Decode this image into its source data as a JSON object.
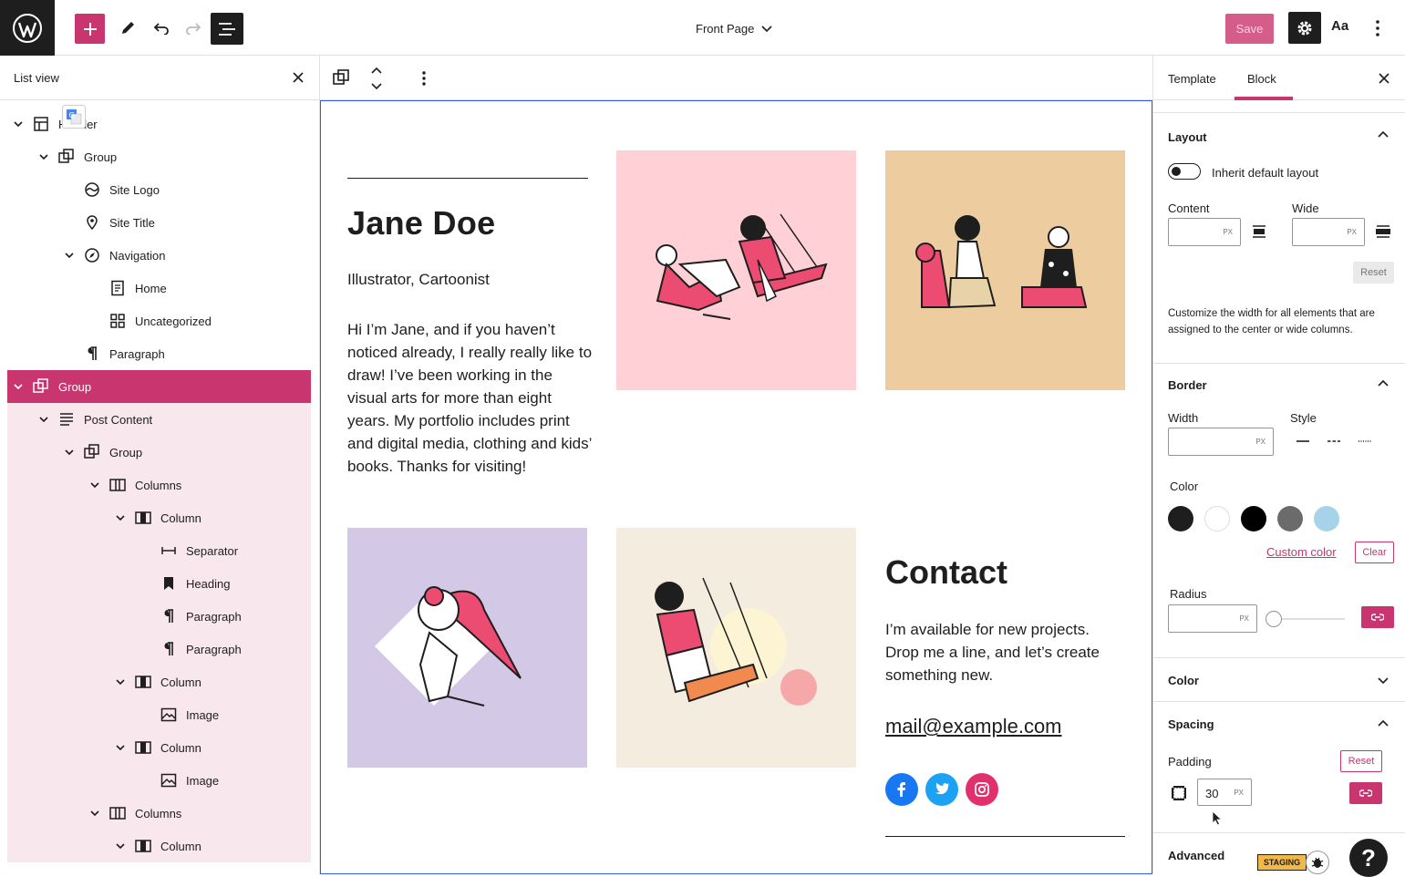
{
  "topbar": {
    "doc_title": "Front Page",
    "save_label": "Save",
    "styles_label": "Aa"
  },
  "list_view": {
    "title": "List view",
    "items": [
      {
        "label": "Header",
        "icon": "template-part-icon",
        "level": 0,
        "expanded": true,
        "state": "normal"
      },
      {
        "label": "Group",
        "icon": "group-icon",
        "level": 1,
        "expanded": true,
        "state": "normal"
      },
      {
        "label": "Site Logo",
        "icon": "site-logo-icon",
        "level": 2,
        "state": "normal"
      },
      {
        "label": "Site Title",
        "icon": "map-pin-icon",
        "level": 2,
        "state": "normal"
      },
      {
        "label": "Navigation",
        "icon": "compass-icon",
        "level": 2,
        "expanded": true,
        "state": "normal"
      },
      {
        "label": "Home",
        "icon": "page-icon",
        "level": 3,
        "state": "normal"
      },
      {
        "label": "Uncategorized",
        "icon": "category-icon",
        "level": 3,
        "state": "normal"
      },
      {
        "label": "Paragraph",
        "icon": "paragraph-icon",
        "level": 2,
        "state": "normal"
      },
      {
        "label": "Group",
        "icon": "group-icon",
        "level": 0,
        "expanded": true,
        "state": "selected"
      },
      {
        "label": "Post Content",
        "icon": "post-content-icon",
        "level": 1,
        "expanded": true,
        "state": "child"
      },
      {
        "label": "Group",
        "icon": "group-icon",
        "level": 2,
        "expanded": true,
        "state": "child"
      },
      {
        "label": "Columns",
        "icon": "columns-icon",
        "level": 3,
        "expanded": true,
        "state": "child"
      },
      {
        "label": "Column",
        "icon": "column-icon",
        "level": 4,
        "expanded": true,
        "state": "child"
      },
      {
        "label": "Separator",
        "icon": "separator-icon",
        "level": 5,
        "state": "child"
      },
      {
        "label": "Heading",
        "icon": "bookmark-icon",
        "level": 5,
        "state": "child"
      },
      {
        "label": "Paragraph",
        "icon": "paragraph-icon",
        "level": 5,
        "state": "child"
      },
      {
        "label": "Paragraph",
        "icon": "paragraph-icon",
        "level": 5,
        "state": "child"
      },
      {
        "label": "Column",
        "icon": "column-icon",
        "level": 4,
        "expanded": true,
        "state": "child"
      },
      {
        "label": "Image",
        "icon": "image-icon",
        "level": 5,
        "state": "child"
      },
      {
        "label": "Column",
        "icon": "column-icon",
        "level": 4,
        "expanded": true,
        "state": "child"
      },
      {
        "label": "Image",
        "icon": "image-icon",
        "level": 5,
        "state": "child"
      },
      {
        "label": "Columns",
        "icon": "columns-icon",
        "level": 3,
        "expanded": true,
        "state": "child"
      },
      {
        "label": "Column",
        "icon": "column-icon",
        "level": 4,
        "expanded": true,
        "state": "child"
      }
    ]
  },
  "canvas": {
    "name": "Jane Doe",
    "subtitle": "Illustrator, Cartoonist",
    "bio": "Hi I’m Jane, and if you haven’t noticed already, I really really like to draw! I’ve been working in the visual arts for more than eight years. My portfolio includes print and digital media, clothing and kids’ books. Thanks for visiting!",
    "contact_heading": "Contact",
    "contact_text": "I’m available for new projects. Drop me a line, and let’s create something new.",
    "email": "mail@example.com",
    "social": [
      "facebook-icon",
      "twitter-icon",
      "instagram-icon"
    ],
    "image_colors": [
      "#ffd1d6",
      "#edcd9f",
      "#d3c8e6",
      "#f5ece0"
    ]
  },
  "sidebar": {
    "tabs": [
      "Template",
      "Block"
    ],
    "active_tab": "Block",
    "layout": {
      "title": "Layout",
      "toggle_label": "Inherit default layout",
      "content_label": "Content",
      "wide_label": "Wide",
      "unit": "PX",
      "reset_label": "Reset",
      "help": "Customize the width for all elements that are assigned to the center or wide columns."
    },
    "border": {
      "title": "Border",
      "width_label": "Width",
      "style_label": "Style",
      "color_label": "Color",
      "custom_color": "Custom color",
      "clear_label": "Clear",
      "radius_label": "Radius",
      "unit": "PX",
      "colors": [
        "#1e1e1e",
        "#ffffff",
        "#000000",
        "#6b6b6b",
        "#a7d3ea"
      ]
    },
    "color": {
      "title": "Color"
    },
    "spacing": {
      "title": "Spacing",
      "padding_label": "Padding",
      "reset_label": "Reset",
      "padding_value": "30",
      "unit": "PX"
    },
    "advanced": {
      "title": "Advanced"
    }
  },
  "staging_label": "STAGING",
  "help_label": "?",
  "accent": "#c9356e"
}
